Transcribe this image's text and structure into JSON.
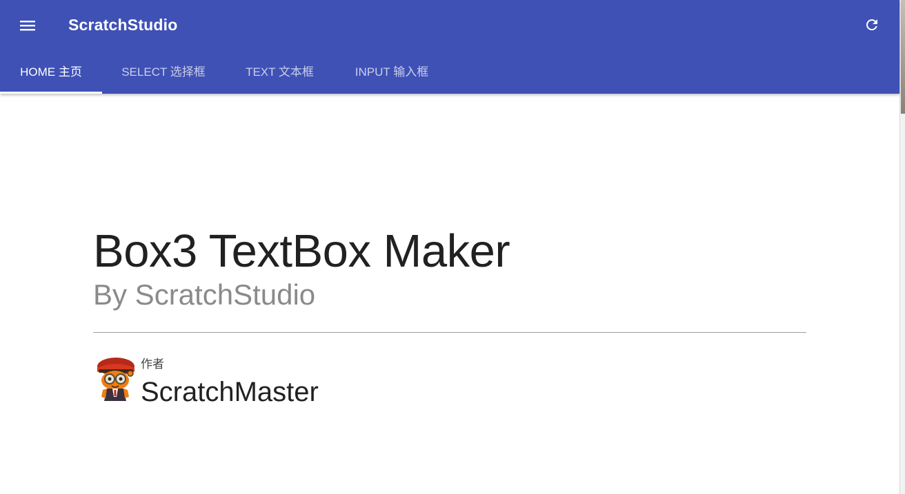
{
  "app": {
    "title": "ScratchStudio",
    "theme_color": "#3f51b5",
    "menu_icon": "hamburger-menu-icon",
    "refresh_icon": "refresh-icon"
  },
  "tabs": [
    {
      "label": "HOME 主页",
      "active": true
    },
    {
      "label": "SELECT 选择框",
      "active": false
    },
    {
      "label": "TEXT 文本框",
      "active": false
    },
    {
      "label": "INPUT 输入框",
      "active": false
    }
  ],
  "hero": {
    "title": "Box3 TextBox Maker",
    "subtitle": "By ScratchStudio"
  },
  "author": {
    "caption": "作者",
    "name": "ScratchMaster",
    "avatar_icon": "author-avatar-icon"
  }
}
